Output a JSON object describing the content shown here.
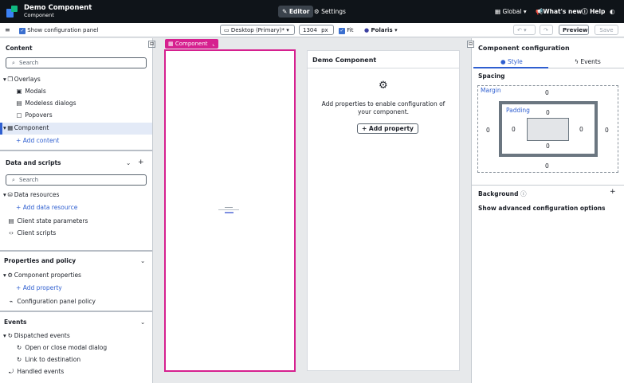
{
  "app": {
    "title": "Demo Component",
    "subtitle": "Component"
  },
  "topnav": {
    "editor": "Editor",
    "settings": "Settings",
    "global": "Global",
    "whats_new": "What's new",
    "help": "Help"
  },
  "toolbar": {
    "show_config": "Show configuration panel",
    "device": "Desktop (Primary)*",
    "width": "1304",
    "unit": "px",
    "fit": "Fit",
    "theme": "Polaris",
    "preview": "Preview",
    "save": "Save"
  },
  "left": {
    "content_title": "Content",
    "search_placeholder": "Search",
    "overlays": "Overlays",
    "modals": "Modals",
    "modeless": "Modeless dialogs",
    "popovers": "Popovers",
    "component": "Component",
    "add_content": "Add content",
    "data_title": "Data and scripts",
    "data_resources": "Data resources",
    "add_data_resource": "Add data resource",
    "client_state": "Client state parameters",
    "client_scripts": "Client scripts",
    "props_title": "Properties and policy",
    "component_props": "Component properties",
    "add_property": "Add property",
    "config_policy": "Configuration panel policy",
    "events_title": "Events",
    "dispatched": "Dispatched events",
    "open_close": "Open or close modal dialog",
    "link_dest": "Link to destination",
    "handled": "Handled events"
  },
  "canvas": {
    "chip": "Component"
  },
  "card": {
    "title": "Demo Component",
    "message": "Add properties to enable configuration of your component.",
    "add_property": "Add property"
  },
  "right": {
    "title": "Component configuration",
    "tab_style": "Style",
    "tab_events": "Events",
    "spacing": "Spacing",
    "margin": "Margin",
    "padding": "Padding",
    "zero": "0",
    "background": "Background",
    "advanced": "Show advanced configuration options"
  },
  "colors": {
    "accent": "#2f5fd0",
    "canvas_pink": "#d6208f",
    "topbar": "#0f1419"
  }
}
